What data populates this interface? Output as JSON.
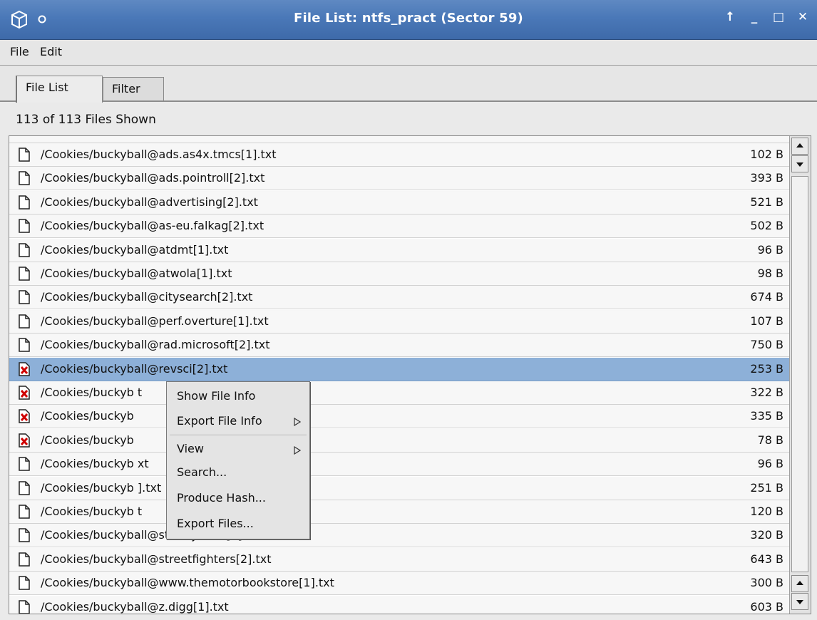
{
  "window": {
    "title": "File List: ntfs_pract (Sector 59)",
    "controls": [
      "↑",
      "_",
      "□",
      "✕"
    ]
  },
  "menubar": {
    "items": [
      "File",
      "Edit"
    ]
  },
  "tabs": [
    {
      "label": "File List",
      "active": true
    },
    {
      "label": "Filter",
      "active": false
    }
  ],
  "status": "113 of 113 Files Shown",
  "files": [
    {
      "name": "/Cookies/buckyball@ads.as4x.tmcs[1].txt",
      "size": "102 B",
      "deleted": false
    },
    {
      "name": "/Cookies/buckyball@ads.pointroll[2].txt",
      "size": "393 B",
      "deleted": false
    },
    {
      "name": "/Cookies/buckyball@advertising[2].txt",
      "size": "521 B",
      "deleted": false
    },
    {
      "name": "/Cookies/buckyball@as-eu.falkag[2].txt",
      "size": "502 B",
      "deleted": false
    },
    {
      "name": "/Cookies/buckyball@atdmt[1].txt",
      "size": "96 B",
      "deleted": false
    },
    {
      "name": "/Cookies/buckyball@atwola[1].txt",
      "size": "98 B",
      "deleted": false
    },
    {
      "name": "/Cookies/buckyball@citysearch[2].txt",
      "size": "674 B",
      "deleted": false
    },
    {
      "name": "/Cookies/buckyball@perf.overture[1].txt",
      "size": "107 B",
      "deleted": false
    },
    {
      "name": "/Cookies/buckyball@rad.microsoft[2].txt",
      "size": "750 B",
      "deleted": false
    },
    {
      "name": "/Cookies/buckyball@revsci[2].txt",
      "size": "253 B",
      "deleted": true,
      "selected": true
    },
    {
      "name": "/Cookies/buckyb                           t",
      "size": "322 B",
      "deleted": true
    },
    {
      "name": "/Cookies/buckyb",
      "size": "335 B",
      "deleted": true
    },
    {
      "name": "/Cookies/buckyb",
      "size": "78 B",
      "deleted": true
    },
    {
      "name": "/Cookies/buckyb                           xt",
      "size": "96 B",
      "deleted": false
    },
    {
      "name": "/Cookies/buckyb                          ].txt",
      "size": "251 B",
      "deleted": false
    },
    {
      "name": "/Cookies/buckyb                           t",
      "size": "120 B",
      "deleted": false
    },
    {
      "name": "/Cookies/buckyball@store.yahoo[3].txt",
      "size": "320 B",
      "deleted": false
    },
    {
      "name": "/Cookies/buckyball@streetfighters[2].txt",
      "size": "643 B",
      "deleted": false
    },
    {
      "name": "/Cookies/buckyball@www.themotorbookstore[1].txt",
      "size": "300 B",
      "deleted": false
    },
    {
      "name": "/Cookies/buckyball@z.digg[1].txt",
      "size": "603 B",
      "deleted": false
    }
  ],
  "context_menu": {
    "items": [
      {
        "label": "Show File Info",
        "submenu": false
      },
      {
        "label": "Export File Info",
        "submenu": true
      },
      {
        "label": "View",
        "submenu": true
      },
      {
        "label": "Search...",
        "submenu": false
      },
      {
        "label": "Produce Hash...",
        "submenu": false
      },
      {
        "label": "Export Files...",
        "submenu": false
      }
    ]
  }
}
